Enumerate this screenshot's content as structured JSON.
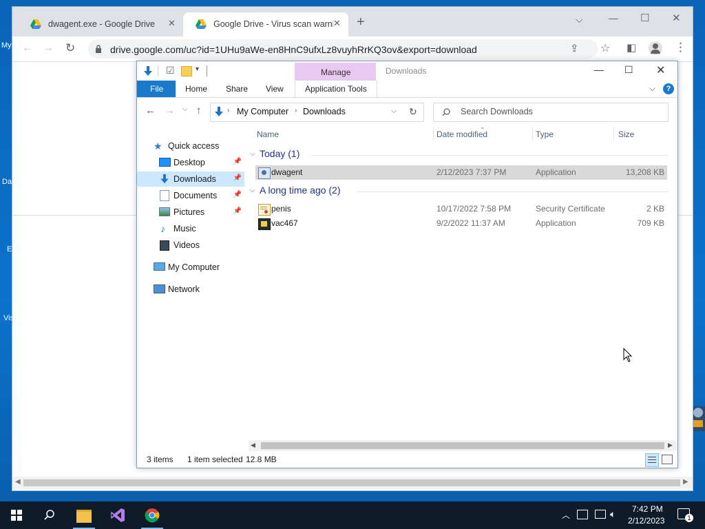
{
  "desktop": {
    "labels": [
      "My",
      "Da",
      "E",
      "Vis"
    ]
  },
  "browser": {
    "tabs": [
      {
        "title": "dwagent.exe - Google Drive",
        "active": false
      },
      {
        "title": "Google Drive - Virus scan warnin",
        "active": true
      }
    ],
    "new_tab": "+",
    "url": "drive.google.com/uc?id=1UHu9aWe-en8HnC9ufxLz8vuyhRrKQ3ov&export=download"
  },
  "explorer": {
    "title": "Downloads",
    "contextual_group": "Manage",
    "ribbon_tabs": [
      "File",
      "Home",
      "Share",
      "View",
      "Application Tools"
    ],
    "breadcrumb": [
      "My Computer",
      "Downloads"
    ],
    "search_placeholder": "Search Downloads",
    "nav": {
      "quick_access": "Quick access",
      "items": [
        {
          "label": "Desktop",
          "pinned": true,
          "icon": "desktop-icon"
        },
        {
          "label": "Downloads",
          "pinned": true,
          "icon": "download-arrow-icon",
          "selected": true
        },
        {
          "label": "Documents",
          "pinned": true,
          "icon": "documents-icon"
        },
        {
          "label": "Pictures",
          "pinned": true,
          "icon": "pictures-icon"
        },
        {
          "label": "Music",
          "pinned": false,
          "icon": "music-note-icon"
        },
        {
          "label": "Videos",
          "pinned": false,
          "icon": "film-icon"
        }
      ],
      "my_computer": "My Computer",
      "network": "Network"
    },
    "columns": [
      "Name",
      "Date modified",
      "Type",
      "Size"
    ],
    "groups": [
      {
        "header": "Today (1)",
        "files": [
          {
            "name": "dwagent",
            "date": "2/12/2023 7:37 PM",
            "type": "Application",
            "size": "13,208 KB",
            "selected": true,
            "icon": "installer-icon"
          }
        ]
      },
      {
        "header": "A long time ago (2)",
        "files": [
          {
            "name": "penis",
            "date": "10/17/2022 7:58 PM",
            "type": "Security Certificate",
            "size": "2 KB",
            "selected": false,
            "icon": "certificate-icon"
          },
          {
            "name": "vac467",
            "date": "9/2/2022 11:37 AM",
            "type": "Application",
            "size": "709 KB",
            "selected": false,
            "icon": "app-icon"
          }
        ]
      }
    ],
    "status": {
      "items": "3 items",
      "selected": "1 item selected",
      "size": "12.8 MB"
    }
  },
  "taskbar": {
    "time": "7:42 PM",
    "date": "2/12/2023",
    "notification_count": "1"
  },
  "colors": {
    "accent": "#1979ca",
    "selection": "#cce8ff",
    "manage": "#e9c8f2"
  }
}
